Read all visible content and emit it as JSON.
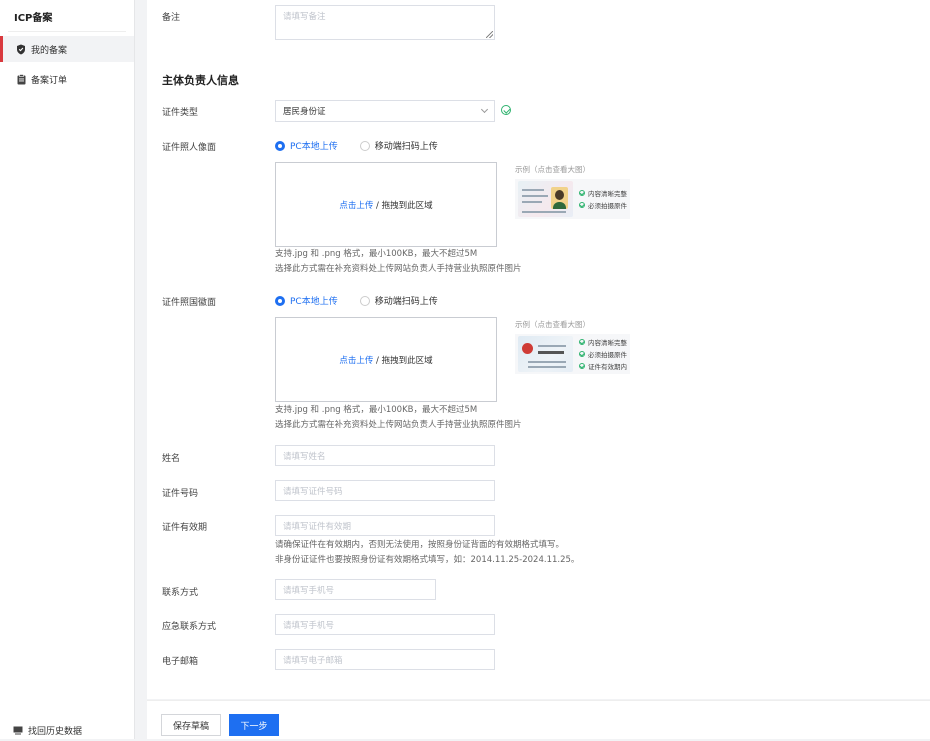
{
  "sidebar": {
    "title": "ICP备案",
    "items": [
      {
        "label": "我的备案",
        "icon": "shield-icon",
        "active": true
      },
      {
        "label": "备案订单",
        "icon": "clipboard-icon",
        "active": false
      }
    ],
    "bottom_label": "找回历史数据",
    "bottom_icon": "monitor-icon"
  },
  "form": {
    "remark": {
      "label": "备注",
      "placeholder": "请填写备注"
    },
    "section_title": "主体负责人信息",
    "cert_type": {
      "label": "证件类型",
      "value": "居民身份证"
    },
    "front": {
      "label": "证件照人像面",
      "radio_pc": "PC本地上传",
      "radio_mobile": "移动端扫码上传",
      "upload_link": "点击上传",
      "upload_rest": " / 拖拽到此区域",
      "hint1": "支持.jpg 和 .png 格式，最小100KB，最大不超过5M",
      "hint2": "选择此方式需在补充资料处上传网站负责人手持营业执照原件图片",
      "example_title": "示例（点击查看大图）",
      "checks": [
        "内容清晰完整",
        "必须拍摄原件"
      ]
    },
    "back": {
      "label": "证件照国徽面",
      "radio_pc": "PC本地上传",
      "radio_mobile": "移动端扫码上传",
      "upload_link": "点击上传",
      "upload_rest": " / 拖拽到此区域",
      "hint1": "支持.jpg 和 .png 格式，最小100KB，最大不超过5M",
      "hint2": "选择此方式需在补充资料处上传网站负责人手持营业执照原件图片",
      "example_title": "示例（点击查看大图）",
      "checks": [
        "内容清晰完整",
        "必须拍摄原件",
        "证件有效期内"
      ]
    },
    "name": {
      "label": "姓名",
      "placeholder": "请填写姓名"
    },
    "cert_no": {
      "label": "证件号码",
      "placeholder": "请填写证件号码"
    },
    "validity": {
      "label": "证件有效期",
      "placeholder": "请填写证件有效期",
      "hint1": "请确保证件在有效期内，否则无法使用，按照身份证背面的有效期格式填写。",
      "hint2": "非身份证证件也要按照身份证有效期格式填写，如：2014.11.25-2024.11.25。"
    },
    "phone": {
      "label": "联系方式",
      "placeholder": "请填写手机号"
    },
    "emergency": {
      "label": "应急联系方式",
      "placeholder": "请填写手机号"
    },
    "email": {
      "label": "电子邮箱",
      "placeholder": "请填写电子邮箱"
    }
  },
  "footer": {
    "draft": "保存草稿",
    "next": "下一步"
  },
  "colors": {
    "primary": "#1e6ff1",
    "active_bar": "#d9393e",
    "success": "#2fb36f"
  }
}
